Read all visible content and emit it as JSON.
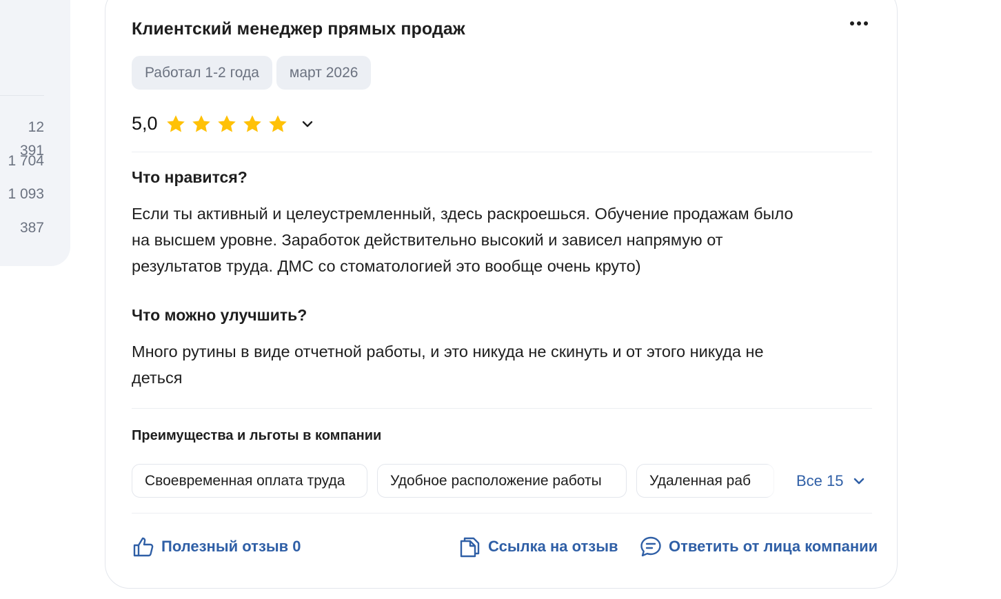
{
  "sidebar": {
    "counts": [
      "12 391",
      "1 704",
      "1 093",
      "387"
    ]
  },
  "review": {
    "title": "Клиентский менеджер прямых продаж",
    "more_icon": "more-horizontal-icon",
    "tags": [
      "Работал 1-2 года",
      "март 2026"
    ],
    "rating": {
      "value_text": "5,0",
      "stars": 5,
      "max_stars": 5,
      "star_color": "#ffc107",
      "expand_icon": "chevron-down-icon"
    },
    "pros": {
      "heading": "Что нравится?",
      "lines": [
        "Если ты активный и целеустремленный, здесь раскроешься. Обучение продажам было",
        "на высшем уровне. Заработок действительно высокий и зависел напрямую от",
        "результатов труда. ДМС со стоматологией это вообще очень круто)"
      ]
    },
    "cons": {
      "heading": "Что можно улучшить?",
      "lines": [
        "Много рутины в виде отчетной работы, и это никуда не скинуть и от этого никуда не",
        "деться"
      ]
    },
    "benefits": {
      "title": "Преимущества и льготы в компании",
      "items": [
        "Своевременная оплата труда",
        "Удобное расположение работы",
        "Удаленная раб"
      ],
      "all_label": "Все 15",
      "all_icon": "chevron-down-icon"
    },
    "actions": {
      "useful": {
        "label": "Полезный отзыв 0",
        "icon": "thumbs-up-icon"
      },
      "link": {
        "label": "Ссылка на отзыв",
        "icon": "copy-icon"
      },
      "reply": {
        "label": "Ответить от лица компании",
        "icon": "chat-bubble-icon"
      }
    }
  },
  "colors": {
    "accent": "#2f5fa6",
    "chip_bg": "#eceff4",
    "sidebar_bg": "#f2f4f8",
    "star": "#ffc107"
  }
}
